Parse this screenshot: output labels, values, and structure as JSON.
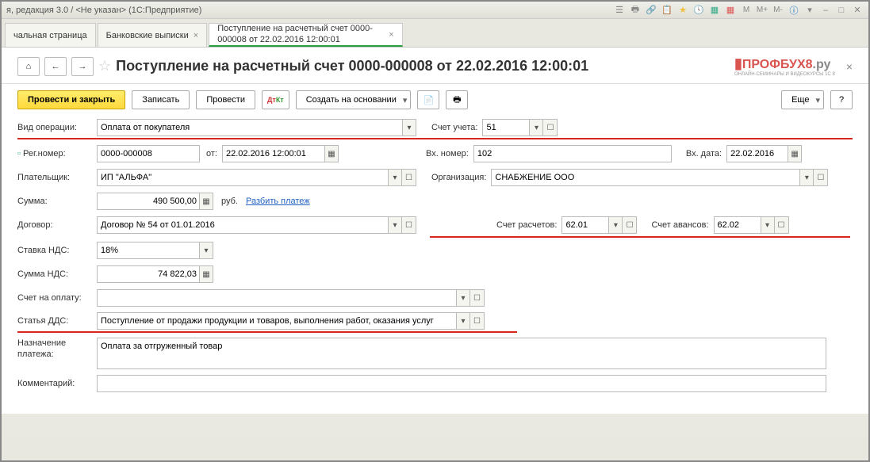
{
  "window_title": "я, редакция 3.0 / <Не указан>  (1С:Предприятие)",
  "tabs": [
    {
      "label": "чальная страница"
    },
    {
      "label": "Банковские выписки"
    },
    {
      "label": "Поступление на расчетный счет 0000-000008 от 22.02.2016 12:00:01",
      "active": true
    }
  ],
  "page_title": "Поступление на расчетный счет 0000-000008 от 22.02.2016 12:00:01",
  "logo": {
    "main": "ПРОФБУХ8",
    "suffix": ".ру",
    "sub": "ОНЛАЙН-СЕМИНАРЫ И ВИДЕОКУРСЫ 1С 8"
  },
  "toolbar": {
    "provesti_zakryt": "Провести и закрыть",
    "zapisat": "Записать",
    "provesti": "Провести",
    "sozdat": "Создать на основании",
    "eshche": "Еще",
    "help": "?"
  },
  "fields": {
    "vid_operacii_label": "Вид операции:",
    "vid_operacii_value": "Оплата от покупателя",
    "schet_ucheta_label": "Счет учета:",
    "schet_ucheta_value": "51",
    "reg_nomer_label": "Рег.номер:",
    "reg_nomer_value": "0000-000008",
    "ot_label": "от:",
    "ot_value": "22.02.2016 12:00:01",
    "vh_nomer_label": "Вх. номер:",
    "vh_nomer_value": "102",
    "vh_data_label": "Вх. дата:",
    "vh_data_value": "22.02.2016",
    "platelshchik_label": "Плательщик:",
    "platelshchik_value": "ИП \"АЛЬФА\"",
    "organizaciya_label": "Организация:",
    "organizaciya_value": "СНАБЖЕНИЕ ООО",
    "summa_label": "Сумма:",
    "summa_value": "490 500,00",
    "rub": "руб.",
    "razbit": "Разбить платеж",
    "dogovor_label": "Договор:",
    "dogovor_value": "Договор № 54 от 01.01.2016",
    "schet_raschetov_label": "Счет расчетов:",
    "schet_raschetov_value": "62.01",
    "schet_avansov_label": "Счет авансов:",
    "schet_avansov_value": "62.02",
    "stavka_nds_label": "Ставка НДС:",
    "stavka_nds_value": "18%",
    "summa_nds_label": "Сумма НДС:",
    "summa_nds_value": "74 822,03",
    "schet_na_oplatu_label": "Счет на оплату:",
    "schet_na_oplatu_value": "",
    "statya_dds_label": "Статья ДДС:",
    "statya_dds_value": "Поступление от продажи продукции и товаров, выполнения работ, оказания услуг",
    "naznachenie_label": "Назначение платежа:",
    "naznachenie_value": "Оплата за отгруженный товар",
    "kommentariy_label": "Комментарий:",
    "kommentariy_value": ""
  }
}
